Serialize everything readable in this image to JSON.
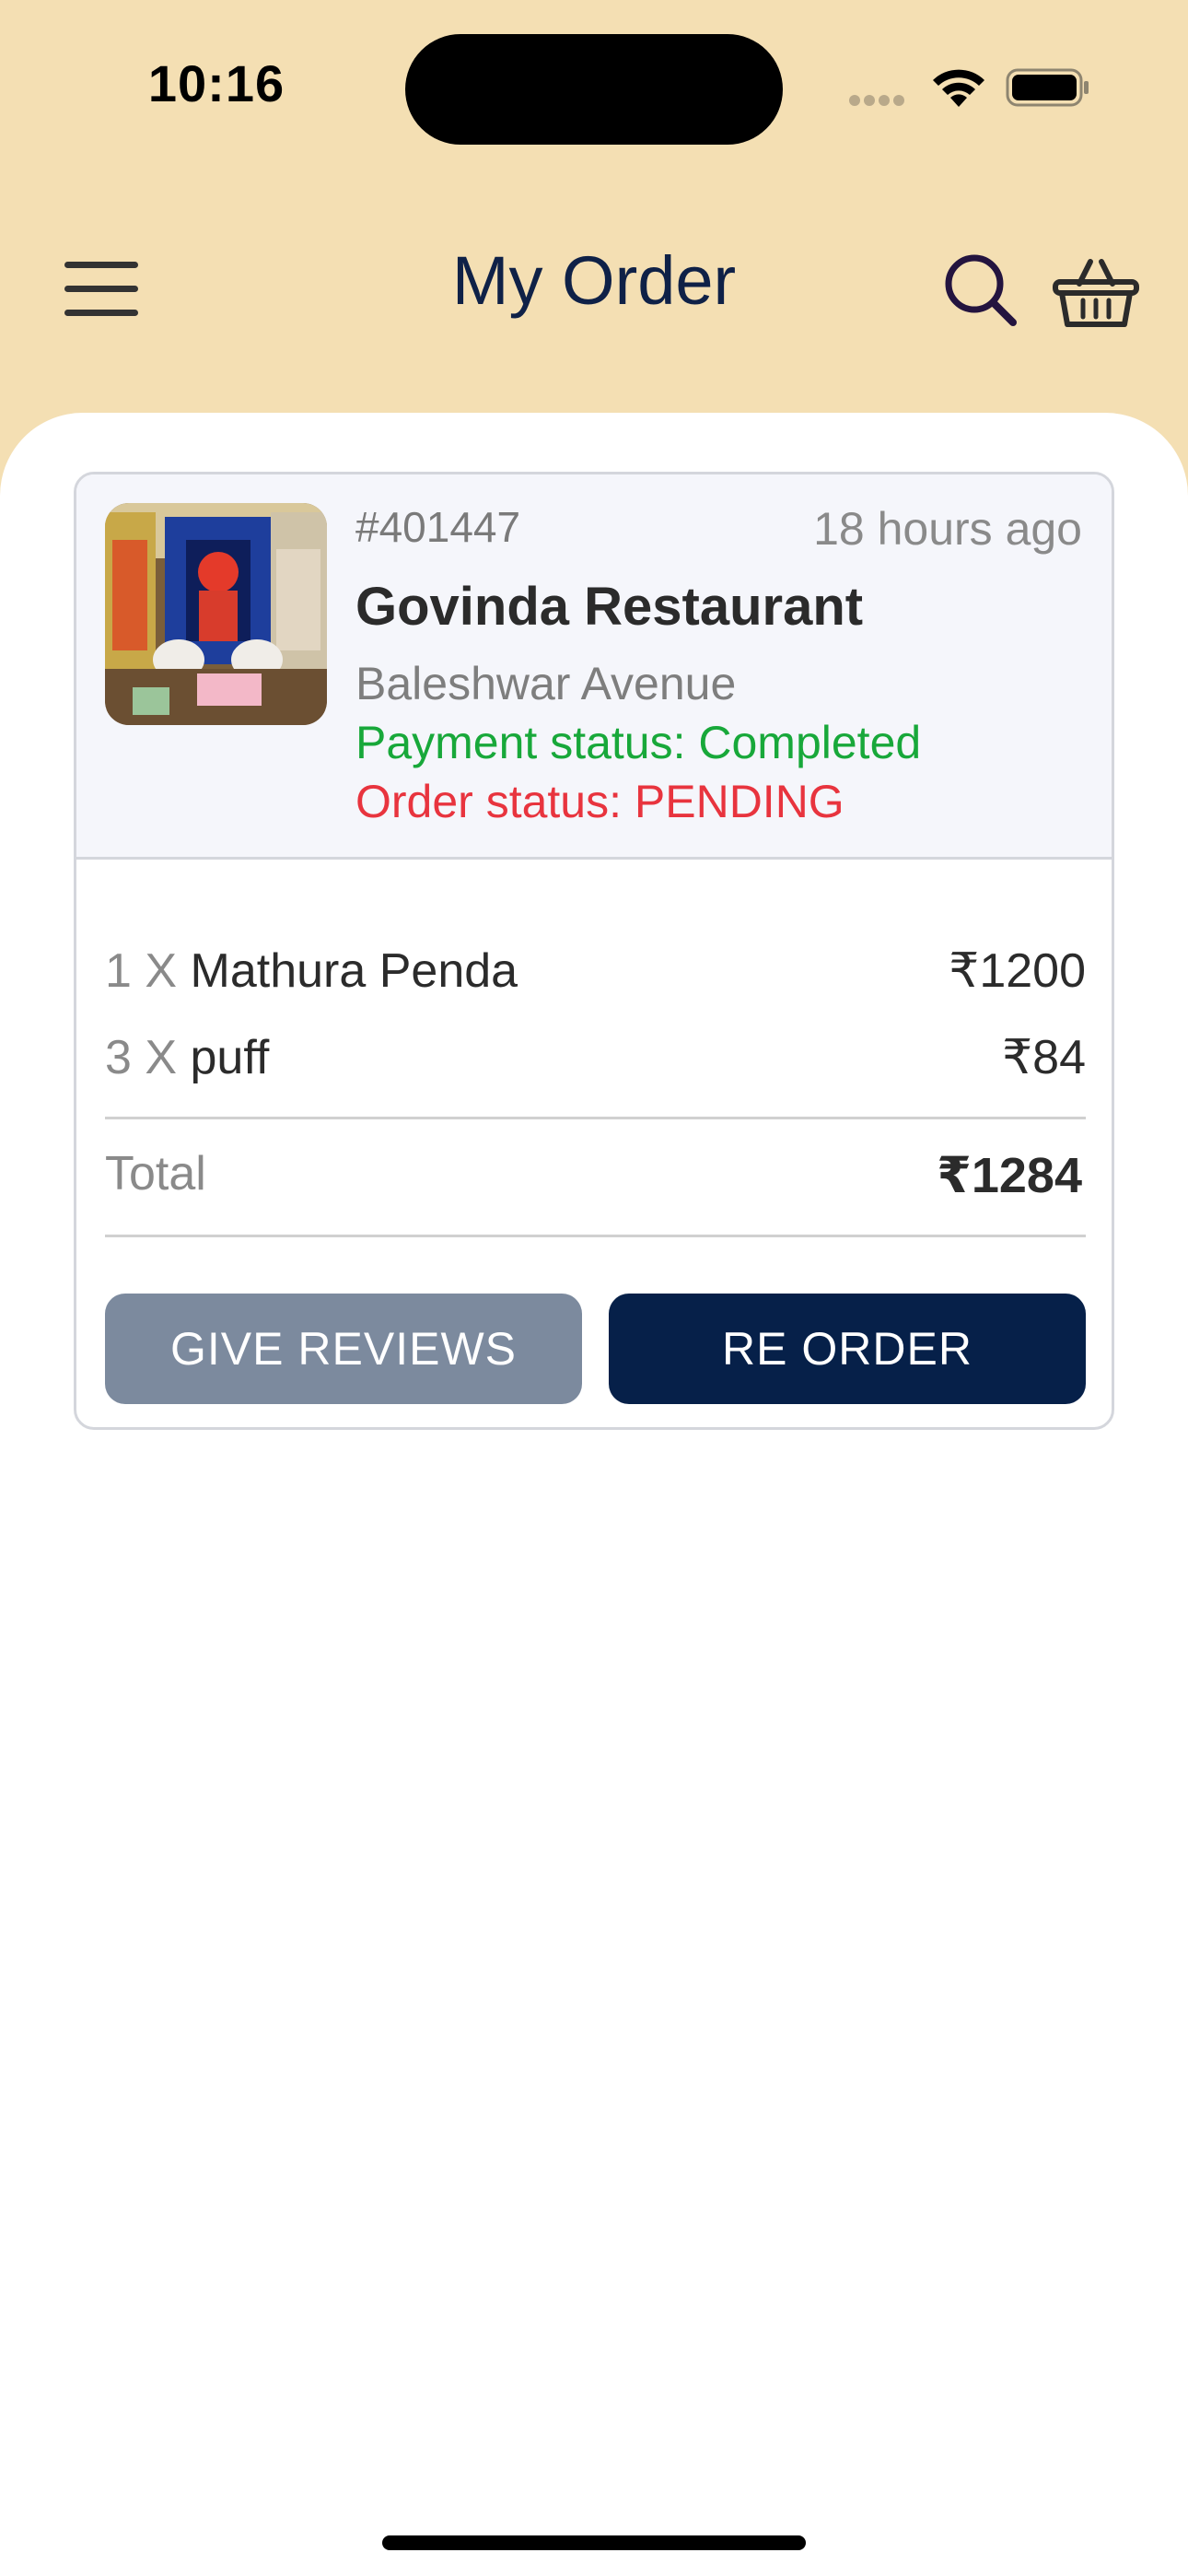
{
  "status_bar": {
    "time": "10:16"
  },
  "header": {
    "title": "My Order",
    "menu_icon": "hamburger-menu-icon",
    "search_icon": "search-icon",
    "cart_icon": "basket-icon"
  },
  "order": {
    "id": "#401447",
    "time_ago": "18 hours ago",
    "restaurant_name": "Govinda Restaurant",
    "address": "Baleshwar Avenue",
    "payment_status": "Payment status: Completed",
    "order_status": "Order status: PENDING",
    "items": [
      {
        "qty": "1 X",
        "name": "Mathura Penda",
        "price": "₹1200"
      },
      {
        "qty": "3 X",
        "name": "puff",
        "price": "₹84"
      }
    ],
    "total_label": "Total",
    "total_value": "₹1284",
    "give_reviews_label": "GIVE REVIEWS",
    "reorder_label": "RE ORDER"
  },
  "colors": {
    "header_bg": "#F4DFB3",
    "title": "#0F2147",
    "payment_completed": "#18A83A",
    "order_pending": "#E8343E",
    "reviews_button": "#7C8A9E",
    "reorder_button": "#062049"
  }
}
